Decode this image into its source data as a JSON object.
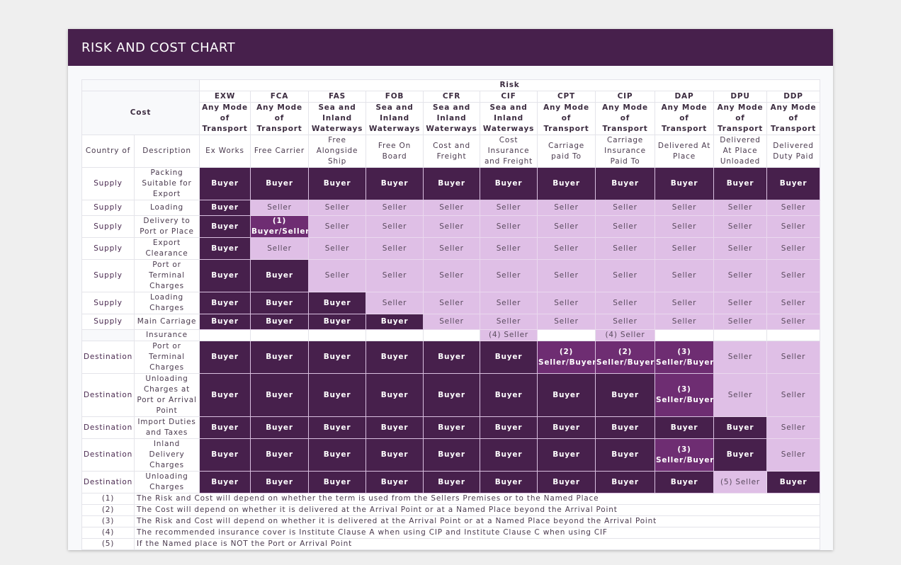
{
  "title": "RISK AND COST CHART",
  "header": {
    "risk_label": "Risk",
    "cost_label": "Cost",
    "country_label": "Country of",
    "description_label": "Description"
  },
  "terms": [
    {
      "code": "EXW",
      "mode": "Any Mode of Transport",
      "name": "Ex Works"
    },
    {
      "code": "FCA",
      "mode": "Any Mode of Transport",
      "name": "Free Carrier"
    },
    {
      "code": "FAS",
      "mode": "Sea and Inland Waterways",
      "name": "Free Alongside Ship"
    },
    {
      "code": "FOB",
      "mode": "Sea and Inland Waterways",
      "name": "Free On Board"
    },
    {
      "code": "CFR",
      "mode": "Sea and Inland Waterways",
      "name": "Cost and Freight"
    },
    {
      "code": "CIF",
      "mode": "Sea and Inland Waterways",
      "name": "Cost Insurance and Freight"
    },
    {
      "code": "CPT",
      "mode": "Any Mode of Transport",
      "name": "Carriage paid To"
    },
    {
      "code": "CIP",
      "mode": "Any Mode of Transport",
      "name": "Carriage Insurance Paid To"
    },
    {
      "code": "DAP",
      "mode": "Any Mode of Transport",
      "name": "Delivered At Place"
    },
    {
      "code": "DPU",
      "mode": "Any Mode of Transport",
      "name": "Delivered At Place Unloaded"
    },
    {
      "code": "DDP",
      "mode": "Any Mode of Transport",
      "name": "Delivered Duty Paid"
    }
  ],
  "rows": [
    {
      "country": "Supply",
      "description": "Packing Suitable for Export",
      "cells": [
        [
          "Buyer",
          "buyer"
        ],
        [
          "Buyer",
          "buyer"
        ],
        [
          "Buyer",
          "buyer"
        ],
        [
          "Buyer",
          "buyer"
        ],
        [
          "Buyer",
          "buyer"
        ],
        [
          "Buyer",
          "buyer"
        ],
        [
          "Buyer",
          "buyer"
        ],
        [
          "Buyer",
          "buyer"
        ],
        [
          "Buyer",
          "buyer"
        ],
        [
          "Buyer",
          "buyer"
        ],
        [
          "Buyer",
          "buyer"
        ]
      ]
    },
    {
      "country": "Supply",
      "description": "Loading",
      "cells": [
        [
          "Buyer",
          "buyer"
        ],
        [
          "Seller",
          "seller"
        ],
        [
          "Seller",
          "seller"
        ],
        [
          "Seller",
          "seller"
        ],
        [
          "Seller",
          "seller"
        ],
        [
          "Seller",
          "seller"
        ],
        [
          "Seller",
          "seller"
        ],
        [
          "Seller",
          "seller"
        ],
        [
          "Seller",
          "seller"
        ],
        [
          "Seller",
          "seller"
        ],
        [
          "Seller",
          "seller"
        ]
      ]
    },
    {
      "country": "Supply",
      "description": "Delivery to Port or Place",
      "cells": [
        [
          "Buyer",
          "buyer"
        ],
        [
          "(1) Buyer/Seller",
          "split"
        ],
        [
          "Seller",
          "seller"
        ],
        [
          "Seller",
          "seller"
        ],
        [
          "Seller",
          "seller"
        ],
        [
          "Seller",
          "seller"
        ],
        [
          "Seller",
          "seller"
        ],
        [
          "Seller",
          "seller"
        ],
        [
          "Seller",
          "seller"
        ],
        [
          "Seller",
          "seller"
        ],
        [
          "Seller",
          "seller"
        ]
      ]
    },
    {
      "country": "Supply",
      "description": "Export Clearance",
      "cells": [
        [
          "Buyer",
          "buyer"
        ],
        [
          "Seller",
          "seller"
        ],
        [
          "Seller",
          "seller"
        ],
        [
          "Seller",
          "seller"
        ],
        [
          "Seller",
          "seller"
        ],
        [
          "Seller",
          "seller"
        ],
        [
          "Seller",
          "seller"
        ],
        [
          "Seller",
          "seller"
        ],
        [
          "Seller",
          "seller"
        ],
        [
          "Seller",
          "seller"
        ],
        [
          "Seller",
          "seller"
        ]
      ]
    },
    {
      "country": "Supply",
      "description": "Port or Terminal Charges",
      "cells": [
        [
          "Buyer",
          "buyer"
        ],
        [
          "Buyer",
          "buyer"
        ],
        [
          "Seller",
          "seller"
        ],
        [
          "Seller",
          "seller"
        ],
        [
          "Seller",
          "seller"
        ],
        [
          "Seller",
          "seller"
        ],
        [
          "Seller",
          "seller"
        ],
        [
          "Seller",
          "seller"
        ],
        [
          "Seller",
          "seller"
        ],
        [
          "Seller",
          "seller"
        ],
        [
          "Seller",
          "seller"
        ]
      ]
    },
    {
      "country": "Supply",
      "description": "Loading Charges",
      "cells": [
        [
          "Buyer",
          "buyer"
        ],
        [
          "Buyer",
          "buyer"
        ],
        [
          "Buyer",
          "buyer"
        ],
        [
          "Seller",
          "seller"
        ],
        [
          "Seller",
          "seller"
        ],
        [
          "Seller",
          "seller"
        ],
        [
          "Seller",
          "seller"
        ],
        [
          "Seller",
          "seller"
        ],
        [
          "Seller",
          "seller"
        ],
        [
          "Seller",
          "seller"
        ],
        [
          "Seller",
          "seller"
        ]
      ]
    },
    {
      "country": "Supply",
      "description": "Main Carriage",
      "cells": [
        [
          "Buyer",
          "buyer"
        ],
        [
          "Buyer",
          "buyer"
        ],
        [
          "Buyer",
          "buyer"
        ],
        [
          "Buyer",
          "buyer"
        ],
        [
          "Seller",
          "seller"
        ],
        [
          "Seller",
          "seller"
        ],
        [
          "Seller",
          "seller"
        ],
        [
          "Seller",
          "seller"
        ],
        [
          "Seller",
          "seller"
        ],
        [
          "Seller",
          "seller"
        ],
        [
          "Seller",
          "seller"
        ]
      ]
    },
    {
      "country": "",
      "description": "Insurance",
      "cells": [
        [
          "",
          "blank"
        ],
        [
          "",
          "blank"
        ],
        [
          "",
          "blank"
        ],
        [
          "",
          "blank"
        ],
        [
          "",
          "blank"
        ],
        [
          "(4) Seller",
          "seller"
        ],
        [
          "",
          "blank"
        ],
        [
          "(4) Seller",
          "seller"
        ],
        [
          "",
          "blank"
        ],
        [
          "",
          "blank"
        ],
        [
          "",
          "blank"
        ]
      ]
    },
    {
      "country": "Destination",
      "description": "Port or Terminal Charges",
      "cells": [
        [
          "Buyer",
          "buyer"
        ],
        [
          "Buyer",
          "buyer"
        ],
        [
          "Buyer",
          "buyer"
        ],
        [
          "Buyer",
          "buyer"
        ],
        [
          "Buyer",
          "buyer"
        ],
        [
          "Buyer",
          "buyer"
        ],
        [
          "(2) Seller/Buyer",
          "split"
        ],
        [
          "(2) Seller/Buyer",
          "split"
        ],
        [
          "(3) Seller/Buyer",
          "split"
        ],
        [
          "Seller",
          "seller"
        ],
        [
          "Seller",
          "seller"
        ]
      ]
    },
    {
      "country": "Destination",
      "description": "Unloading Charges at Port or Arrival Point",
      "cells": [
        [
          "Buyer",
          "buyer"
        ],
        [
          "Buyer",
          "buyer"
        ],
        [
          "Buyer",
          "buyer"
        ],
        [
          "Buyer",
          "buyer"
        ],
        [
          "Buyer",
          "buyer"
        ],
        [
          "Buyer",
          "buyer"
        ],
        [
          "Buyer",
          "buyer"
        ],
        [
          "Buyer",
          "buyer"
        ],
        [
          "(3) Seller/Buyer",
          "split"
        ],
        [
          "Seller",
          "seller"
        ],
        [
          "Seller",
          "seller"
        ]
      ]
    },
    {
      "country": "Destination",
      "description": "Import Duties and Taxes",
      "cells": [
        [
          "Buyer",
          "buyer"
        ],
        [
          "Buyer",
          "buyer"
        ],
        [
          "Buyer",
          "buyer"
        ],
        [
          "Buyer",
          "buyer"
        ],
        [
          "Buyer",
          "buyer"
        ],
        [
          "Buyer",
          "buyer"
        ],
        [
          "Buyer",
          "buyer"
        ],
        [
          "Buyer",
          "buyer"
        ],
        [
          "Buyer",
          "buyer"
        ],
        [
          "Buyer",
          "buyer"
        ],
        [
          "Seller",
          "seller"
        ]
      ]
    },
    {
      "country": "Destination",
      "description": "Inland Delivery Charges",
      "cells": [
        [
          "Buyer",
          "buyer"
        ],
        [
          "Buyer",
          "buyer"
        ],
        [
          "Buyer",
          "buyer"
        ],
        [
          "Buyer",
          "buyer"
        ],
        [
          "Buyer",
          "buyer"
        ],
        [
          "Buyer",
          "buyer"
        ],
        [
          "Buyer",
          "buyer"
        ],
        [
          "Buyer",
          "buyer"
        ],
        [
          "(3) Seller/Buyer",
          "split"
        ],
        [
          "Buyer",
          "buyer"
        ],
        [
          "Seller",
          "seller"
        ]
      ]
    },
    {
      "country": "Destination",
      "description": "Unloading Charges",
      "cells": [
        [
          "Buyer",
          "buyer"
        ],
        [
          "Buyer",
          "buyer"
        ],
        [
          "Buyer",
          "buyer"
        ],
        [
          "Buyer",
          "buyer"
        ],
        [
          "Buyer",
          "buyer"
        ],
        [
          "Buyer",
          "buyer"
        ],
        [
          "Buyer",
          "buyer"
        ],
        [
          "Buyer",
          "buyer"
        ],
        [
          "Buyer",
          "buyer"
        ],
        [
          "(5) Seller",
          "seller"
        ],
        [
          "Buyer",
          "buyer"
        ]
      ]
    }
  ],
  "notes": [
    {
      "num": "(1)",
      "text": "The Risk and Cost will depend on whether the term is used from the Sellers Premises or to the Named Place"
    },
    {
      "num": "(2)",
      "text": "The Cost will depend on whether it is delivered at the Arrival Point or at a Named Place beyond the Arrival Point"
    },
    {
      "num": "(3)",
      "text": "The Risk and Cost will depend on whether it is delivered at the Arrival Point or at a Named Place beyond the Arrival Point"
    },
    {
      "num": "(4)",
      "text": "The recommended insurance cover is Institute Clause A when using CIP and Institute Clause C when using CIF"
    },
    {
      "num": "(5)",
      "text": "If the Named place is NOT the Port or Arrival Point"
    }
  ],
  "colors": {
    "header_bg": "#47204c",
    "buyer": "#47204c",
    "seller": "#dfbfe6",
    "split": "#6e2d72"
  }
}
